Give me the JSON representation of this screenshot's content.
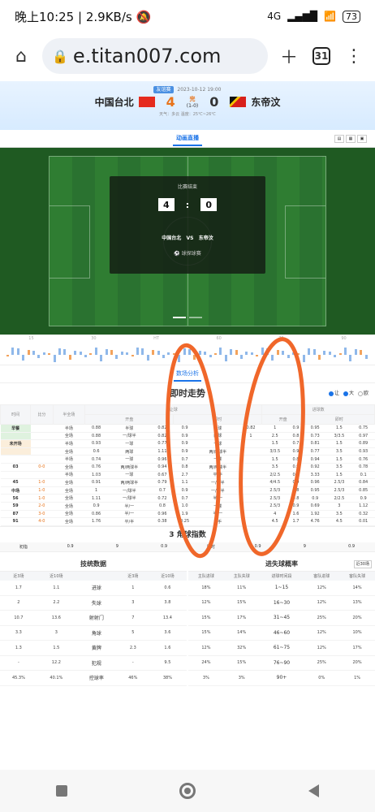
{
  "status_bar": {
    "time": "晚上10:25",
    "speed": "2.9KB/s",
    "network": "4G",
    "battery": "73"
  },
  "browser": {
    "url": "e.titan007.com",
    "tab_count": "31"
  },
  "match": {
    "league_badge": "友谊赛",
    "datetime": "2023-10-12 19:00",
    "home_team": "中国台北",
    "away_team": "东帝汶",
    "home_score": "4",
    "away_score": "0",
    "status": "完",
    "half_score": "(1-0)",
    "weather": "天气：多云    温度：25℃~26℃"
  },
  "live_tab": "动画直播",
  "overlay": {
    "title": "比赛结束",
    "home_score": "4",
    "away_score": "0",
    "colon": ":",
    "home": "中国台北",
    "vs": "VS",
    "away": "东帝汶",
    "brand": "球探球赛"
  },
  "timeline_labels": [
    "15",
    "30",
    "HT",
    "60",
    "75",
    "90"
  ],
  "analysis_tab": "数场分析",
  "trend": {
    "title": "即时走势",
    "opt_let": "让",
    "opt_big": "大",
    "opt_euro": "欧",
    "group_let": "让球",
    "group_total": "进球数"
  },
  "odds_headers": [
    "时间",
    "比分",
    "半全场",
    "",
    "开盘",
    "",
    "",
    "即时",
    "",
    "",
    "开盘",
    "",
    "",
    "即时",
    ""
  ],
  "odds_rows": [
    {
      "t": "早餐",
      "s": "",
      "h": "半场",
      "c": [
        "0.88",
        "半球",
        "0.82",
        "0.9",
        "一球",
        "0.82",
        "",
        "1",
        "0.9",
        "0.95",
        "1.5",
        "0.75"
      ],
      "cls": "bg-green"
    },
    {
      "t": "",
      "s": "",
      "h": "全场",
      "c": [
        "0.88",
        "一/球半",
        "0.82",
        "0.9",
        "两球",
        "1",
        "",
        "2.5",
        "0.8",
        "0.73",
        "3/3.5",
        "0.97"
      ],
      "cls": "bg-green"
    },
    {
      "t": "未开场",
      "s": "",
      "h": "半场",
      "c": [
        "0.93",
        "一球",
        "0.77",
        "0.9",
        "一球",
        "",
        "",
        "1.5",
        "0.7",
        "0.81",
        "1.5",
        "0.89"
      ],
      "cls": "bg-orange"
    },
    {
      "t": "",
      "s": "",
      "h": "全场",
      "c": [
        "0.6",
        "两球",
        "1.11",
        "0.9",
        "两/两球半",
        "",
        "",
        "3/3.5",
        "0.9",
        "0.77",
        "3.5",
        "0.93"
      ],
      "cls": "bg-orange"
    },
    {
      "t": "",
      "s": "",
      "h": "半场",
      "c": [
        "0.74",
        "一球",
        "0.96",
        "0.7",
        "一球",
        "",
        "",
        "1.5",
        "0.8",
        "0.94",
        "1.5",
        "0.76"
      ]
    },
    {
      "t": "03",
      "s": "0-0",
      "h": "全场",
      "c": [
        "0.76",
        "两/两球半",
        "0.94",
        "0.8",
        "两/两球半",
        "",
        "",
        "3.5",
        "0.9",
        "0.92",
        "3.5",
        "0.78"
      ]
    },
    {
      "t": "",
      "s": "",
      "h": "半场",
      "c": [
        "1.03",
        "一球",
        "0.67",
        "2.7",
        "平/半",
        "",
        "",
        "2/2.5",
        "0.9",
        "3.33",
        "1.5",
        "0.1"
      ]
    },
    {
      "t": "45",
      "s": "1-0",
      "h": "全场",
      "c": [
        "0.91",
        "两/两球半",
        "0.79",
        "1.1",
        "一/球半",
        "",
        "",
        "4/4.5",
        "0.9",
        "0.96",
        "2.5/3",
        "0.84"
      ]
    },
    {
      "t": "中场",
      "s": "1-0",
      "h": "全场",
      "c": [
        "1",
        "一/球半",
        "0.7",
        "0.9",
        "一/球半",
        "",
        "",
        "2.5/3",
        "0.8",
        "0.95",
        "2.5/3",
        "0.85"
      ]
    },
    {
      "t": "56",
      "s": "1-0",
      "h": "全场",
      "c": [
        "1.11",
        "一/球半",
        "0.72",
        "0.7",
        "半/一",
        "",
        "",
        "2.5/3",
        "0.8",
        "0.9",
        "2/2.5",
        "0.9"
      ]
    },
    {
      "t": "59",
      "s": "2-0",
      "h": "全场",
      "c": [
        "0.9",
        "半/一",
        "0.8",
        "1.0",
        "一球",
        "",
        "",
        "2.5/3",
        "0.9",
        "0.69",
        "3",
        "1.12"
      ]
    },
    {
      "t": "87",
      "s": "3-0",
      "h": "全场",
      "c": [
        "0.86",
        "半/一",
        "0.96",
        "1.9",
        "半/一",
        "",
        "",
        "4",
        "1.6",
        "1.92",
        "3.5",
        "0.32"
      ]
    },
    {
      "t": "91",
      "s": "4-0",
      "h": "全场",
      "c": [
        "1.76",
        "平/半",
        "0.38",
        "0.25",
        "平手",
        "",
        "",
        "4.5",
        "1.7",
        "4.76",
        "4.5",
        "0.01"
      ]
    }
  ],
  "corner": {
    "title": "3 角球指数",
    "row": [
      "初指",
      "0.9",
      "9",
      "0.9",
      "即时",
      "0.9",
      "9",
      "0.9"
    ]
  },
  "tech_stats": {
    "title": "技统数据",
    "headers": [
      "近3场",
      "近10场",
      "",
      "近3场",
      "近10场"
    ],
    "rows": [
      {
        "a": "1.7",
        "b": "1.1",
        "label": "进球",
        "c": "1",
        "d": "0.6"
      },
      {
        "a": "2",
        "b": "2.2",
        "label": "失球",
        "c": "3",
        "d": "3.8"
      },
      {
        "a": "10.7",
        "b": "13.6",
        "label": "射射门",
        "c": "7",
        "d": "13.4"
      },
      {
        "a": "3.3",
        "b": "3",
        "label": "角球",
        "c": "5",
        "d": "3.6"
      },
      {
        "a": "1.3",
        "b": "1.5",
        "label": "黄牌",
        "c": "2.3",
        "d": "1.6"
      },
      {
        "a": "-",
        "b": "12.2",
        "label": "犯规",
        "c": "-",
        "d": "9.5"
      },
      {
        "a": "45.3%",
        "b": "40.1%",
        "label": "控球率",
        "c": "46%",
        "d": "38%"
      }
    ]
  },
  "goal_prob": {
    "title": "进失球概率",
    "selector": "近30场",
    "headers": [
      "主队进球",
      "主队失球",
      "进球时间段",
      "客队进球",
      "客队失球"
    ],
    "rows": [
      {
        "a": "18%",
        "b": "11%",
        "label": "1~15",
        "c": "12%",
        "d": "14%"
      },
      {
        "a": "12%",
        "b": "15%",
        "label": "16~30",
        "c": "12%",
        "d": "13%"
      },
      {
        "a": "15%",
        "b": "17%",
        "label": "31~45",
        "c": "25%",
        "d": "20%"
      },
      {
        "a": "15%",
        "b": "14%",
        "label": "46~60",
        "c": "12%",
        "d": "10%"
      },
      {
        "a": "12%",
        "b": "32%",
        "label": "61~75",
        "c": "12%",
        "d": "17%"
      },
      {
        "a": "24%",
        "b": "15%",
        "label": "76~90",
        "c": "25%",
        "d": "20%"
      },
      {
        "a": "3%",
        "b": "3%",
        "label": "90+",
        "c": "0%",
        "d": "1%"
      }
    ]
  }
}
